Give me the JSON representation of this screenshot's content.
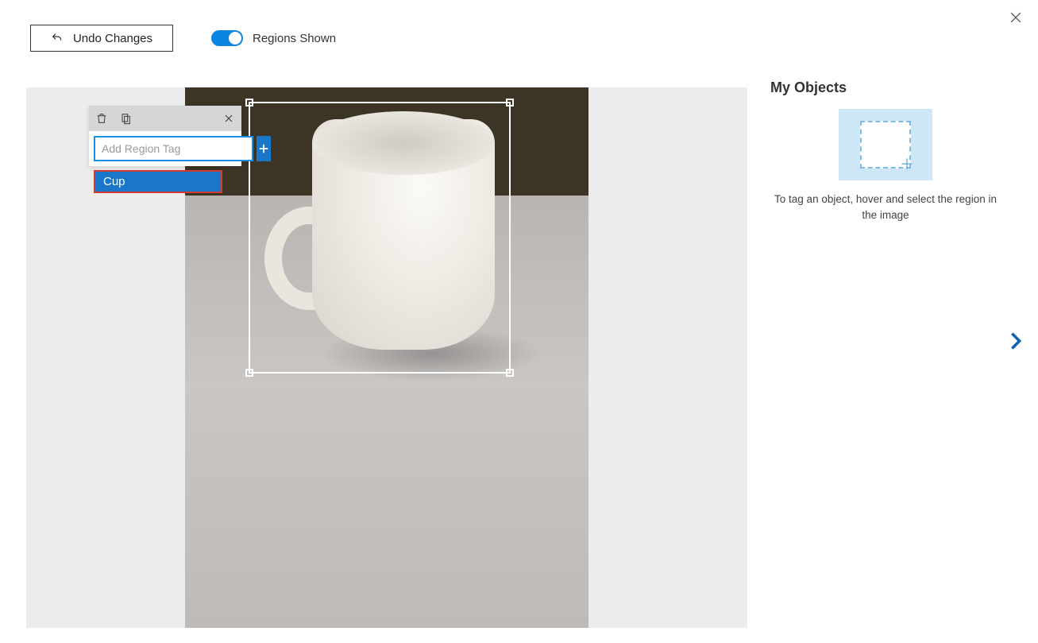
{
  "toolbar": {
    "undo_label": "Undo Changes",
    "regions_toggle_label": "Regions Shown",
    "regions_toggle_on": true
  },
  "tag_popup": {
    "input_value": "",
    "input_placeholder": "Add Region Tag",
    "suggestions": [
      "Cup"
    ]
  },
  "sidebar": {
    "title": "My Objects",
    "help_text": "To tag an object, hover and select the region in the image"
  }
}
